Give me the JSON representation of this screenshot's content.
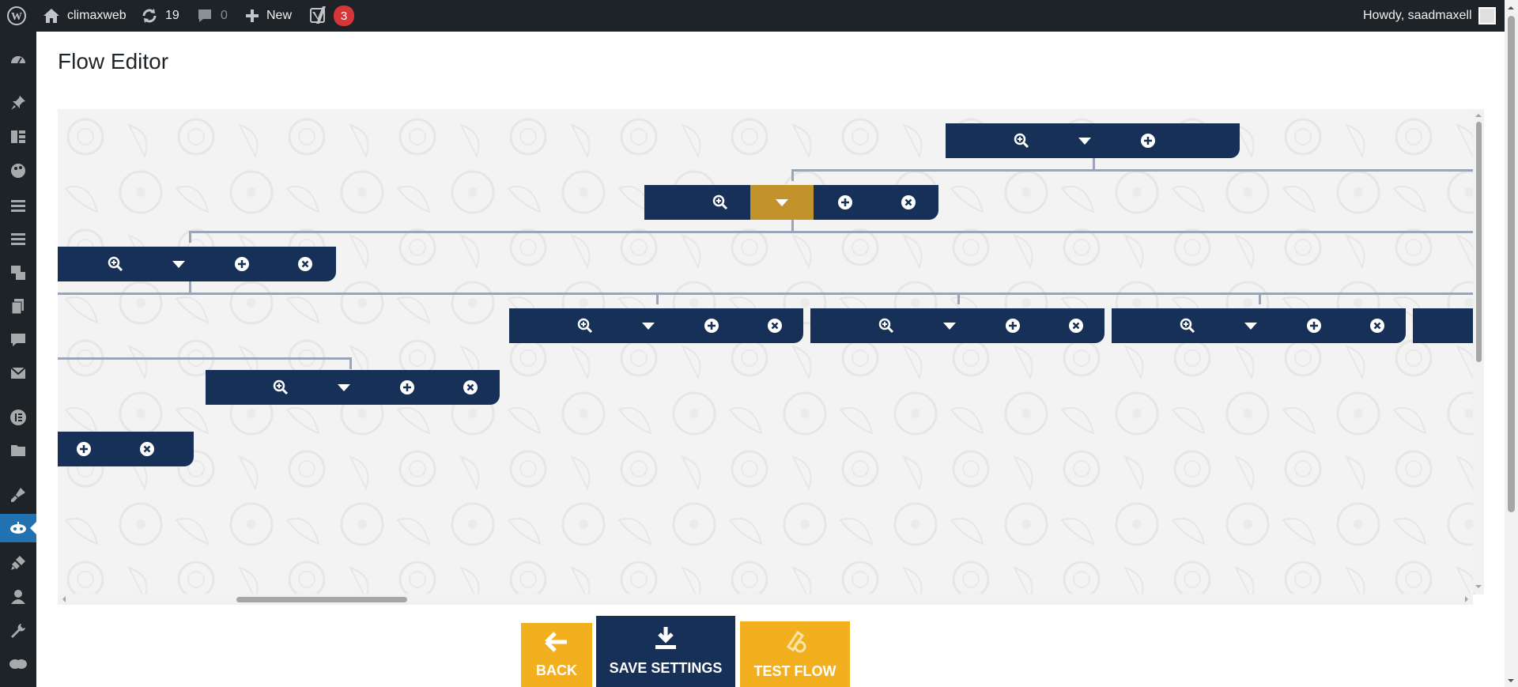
{
  "adminbar": {
    "site_name": "climaxweb",
    "updates_count": "19",
    "comments_count": "0",
    "new_label": "New",
    "yoast_badge": "3",
    "greeting": "Howdy, saadmaxell"
  },
  "sidebar": {
    "icons": [
      "dashboard-icon",
      "pin-icon",
      "posts-icon",
      "palette-icon",
      "menu-icon",
      "menu-icon",
      "media-icon",
      "pages-icon",
      "comments-icon",
      "mail-icon",
      "elementor-icon",
      "folder-icon",
      "brush-icon",
      "chatbot-icon",
      "plugins-icon",
      "users-icon",
      "tools-icon",
      "settings-icon"
    ],
    "active_index": 13
  },
  "page": {
    "title": "Flow Editor"
  },
  "colors": {
    "node": "#163058",
    "node_highlight": "#c2932a",
    "connector": "#9aa6b6",
    "button_yellow": "#f2b01e",
    "button_navy": "#163058"
  },
  "buttons": {
    "back": "BACK",
    "save": "SAVE SETTINGS",
    "test": "TEST FLOW"
  }
}
